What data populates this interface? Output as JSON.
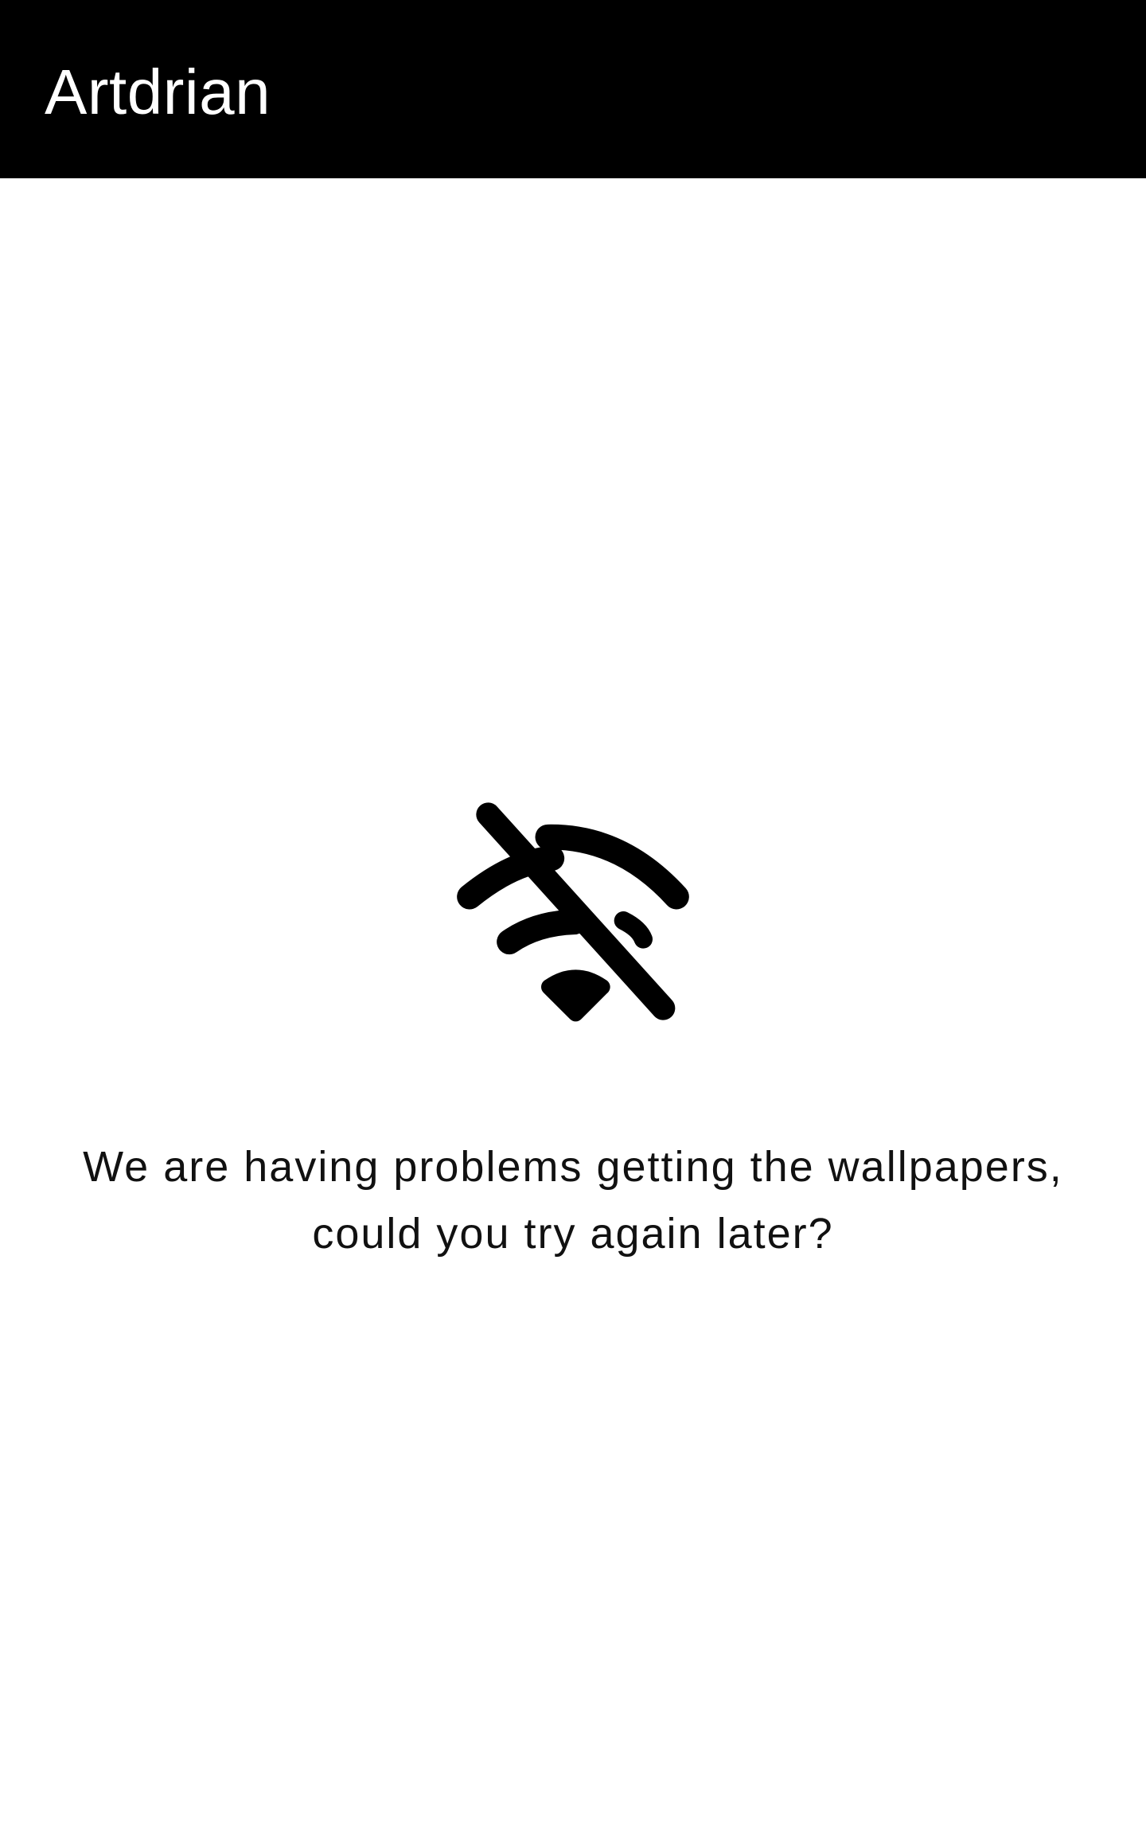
{
  "app_bar": {
    "title": "Artdrian",
    "background_color": "#000000",
    "title_color": "#ffffff"
  },
  "empty_state": {
    "icon": "wifi-off-icon",
    "message_lines": [
      "We are having problems getting the wallpapers,",
      "could you try again later?"
    ],
    "text_color": "#111111"
  }
}
